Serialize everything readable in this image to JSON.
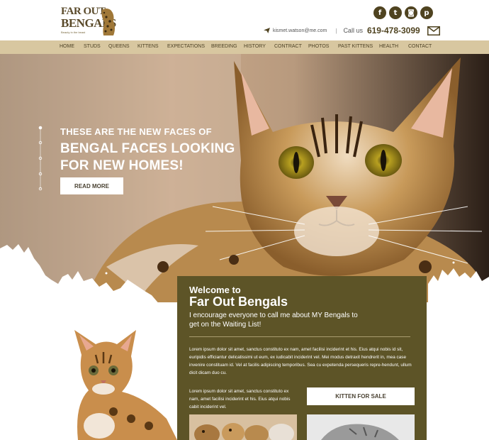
{
  "brand": {
    "logo_line1": "FAR OUT",
    "logo_line2": "BENGALS",
    "logo_tagline": "Beauty in the beast"
  },
  "socials": [
    {
      "name": "facebook",
      "glyph": "f"
    },
    {
      "name": "twitter",
      "glyph": "t"
    },
    {
      "name": "instagram",
      "glyph": "◙"
    },
    {
      "name": "pinterest",
      "glyph": "p"
    }
  ],
  "contact": {
    "email": "kismet.watson@me.com",
    "separator": "|",
    "call_label": "Call us",
    "phone": "619-478-3099"
  },
  "nav": [
    "HOME",
    "STUDS",
    "QUEENS",
    "KITTENS",
    "EXPECTATIONS",
    "BREEDING",
    "HISTORY",
    "CONTRACT",
    "PHOTOS",
    "PAST KITTENS",
    "HEALTH",
    "CONTACT"
  ],
  "hero": {
    "line1": "THESE ARE THE NEW FACES OF",
    "line2": "BENGAL FACES LOOKING",
    "line3": "FOR NEW HOMES!",
    "button": "READ MORE"
  },
  "welcome": {
    "line1": "Welcome to",
    "line2": "Far Out Bengals",
    "subtitle": "I encourage everyone to call me about MY Bengals to get on the Waiting List!",
    "para1": "Lorem ipsum dolor sit amet, sanctus constituto ex nam, amet facilisi inciderint et his. Eius atqui nobis id sit, euripidis efficiantur delicatissimi ut eum, ex iudicabit inciderint vel. Mei modus detraxit hendrerit in, mea case invenire constituam id. Vel at facilis adipiscing temporibus. Sea cu expetenda persequeris repre-hendunt, ullum dicit dicam duo cu.",
    "para2": "Lorem ipsum dolor sit amet, sanctus constituto ex nam, amet facilisi inciderint et his. Eius atqui nobis cabit inciderint vel.",
    "kitten_button": "KITTEN FOR SALE"
  },
  "colors": {
    "nav_bg": "#d8c7a0",
    "welcome_bg": "#5d5427",
    "brand_dark": "#4f4320"
  }
}
